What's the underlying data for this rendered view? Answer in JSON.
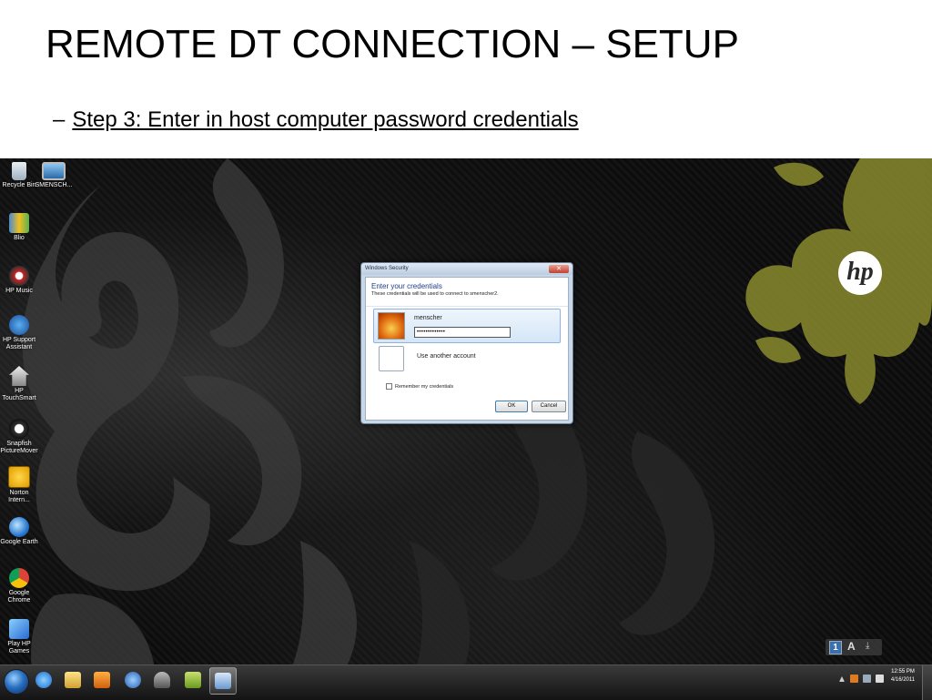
{
  "slide": {
    "title": "REMOTE DT CONNECTION – SETUP",
    "bullet_dash": "–",
    "bullet_text": "Step 3:  Enter in host computer password credentials"
  },
  "desktop": {
    "icons": [
      {
        "label": "Recycle Bin",
        "icon": "recycle-bin-icon"
      },
      {
        "label": "SMENSCH...",
        "icon": "computer-icon"
      },
      {
        "label": "Blio",
        "icon": "blio-icon"
      },
      {
        "label": "HP Music",
        "icon": "hp-music-icon"
      },
      {
        "label": "HP Support Assistant",
        "icon": "hp-support-icon"
      },
      {
        "label": "HP TouchSmart",
        "icon": "hp-touchsmart-icon"
      },
      {
        "label": "Snapfish PictureMover",
        "icon": "snapfish-icon"
      },
      {
        "label": "Norton Intern...",
        "icon": "norton-icon"
      },
      {
        "label": "Google Earth",
        "icon": "google-earth-icon"
      },
      {
        "label": "Google Chrome",
        "icon": "chrome-icon"
      },
      {
        "label": "Play HP Games",
        "icon": "hp-games-icon"
      }
    ],
    "logo_text": "hp"
  },
  "dialog": {
    "window_title": "Windows Security",
    "close_glyph": "✕",
    "heading": "Enter your credentials",
    "subheading": "These credentials will be used to connect to smenscher2.",
    "username": "menscher",
    "password_mask": "•••••••••••••",
    "other_account": "Use another account",
    "remember_label": "Remember my credentials",
    "remember_checked": false,
    "ok_label": "OK",
    "cancel_label": "Cancel"
  },
  "language_bar": {
    "number": "1",
    "letter": "A",
    "arrow": "⤓"
  },
  "taskbar": {
    "apps": [
      "windows-explorer-icon",
      "internet-explorer-icon",
      "file-explorer-icon",
      "media-player-icon",
      "hp-support-icon",
      "device-icon",
      "hp-app-icon",
      "remote-desktop-icon"
    ],
    "clock_time": "12:55 PM",
    "clock_date": "4/16/2011"
  },
  "colors": {
    "dialog_accent": "#1e3c8c",
    "hp_gold": "#8a8a2e",
    "taskbar": "#1e1e1e"
  }
}
